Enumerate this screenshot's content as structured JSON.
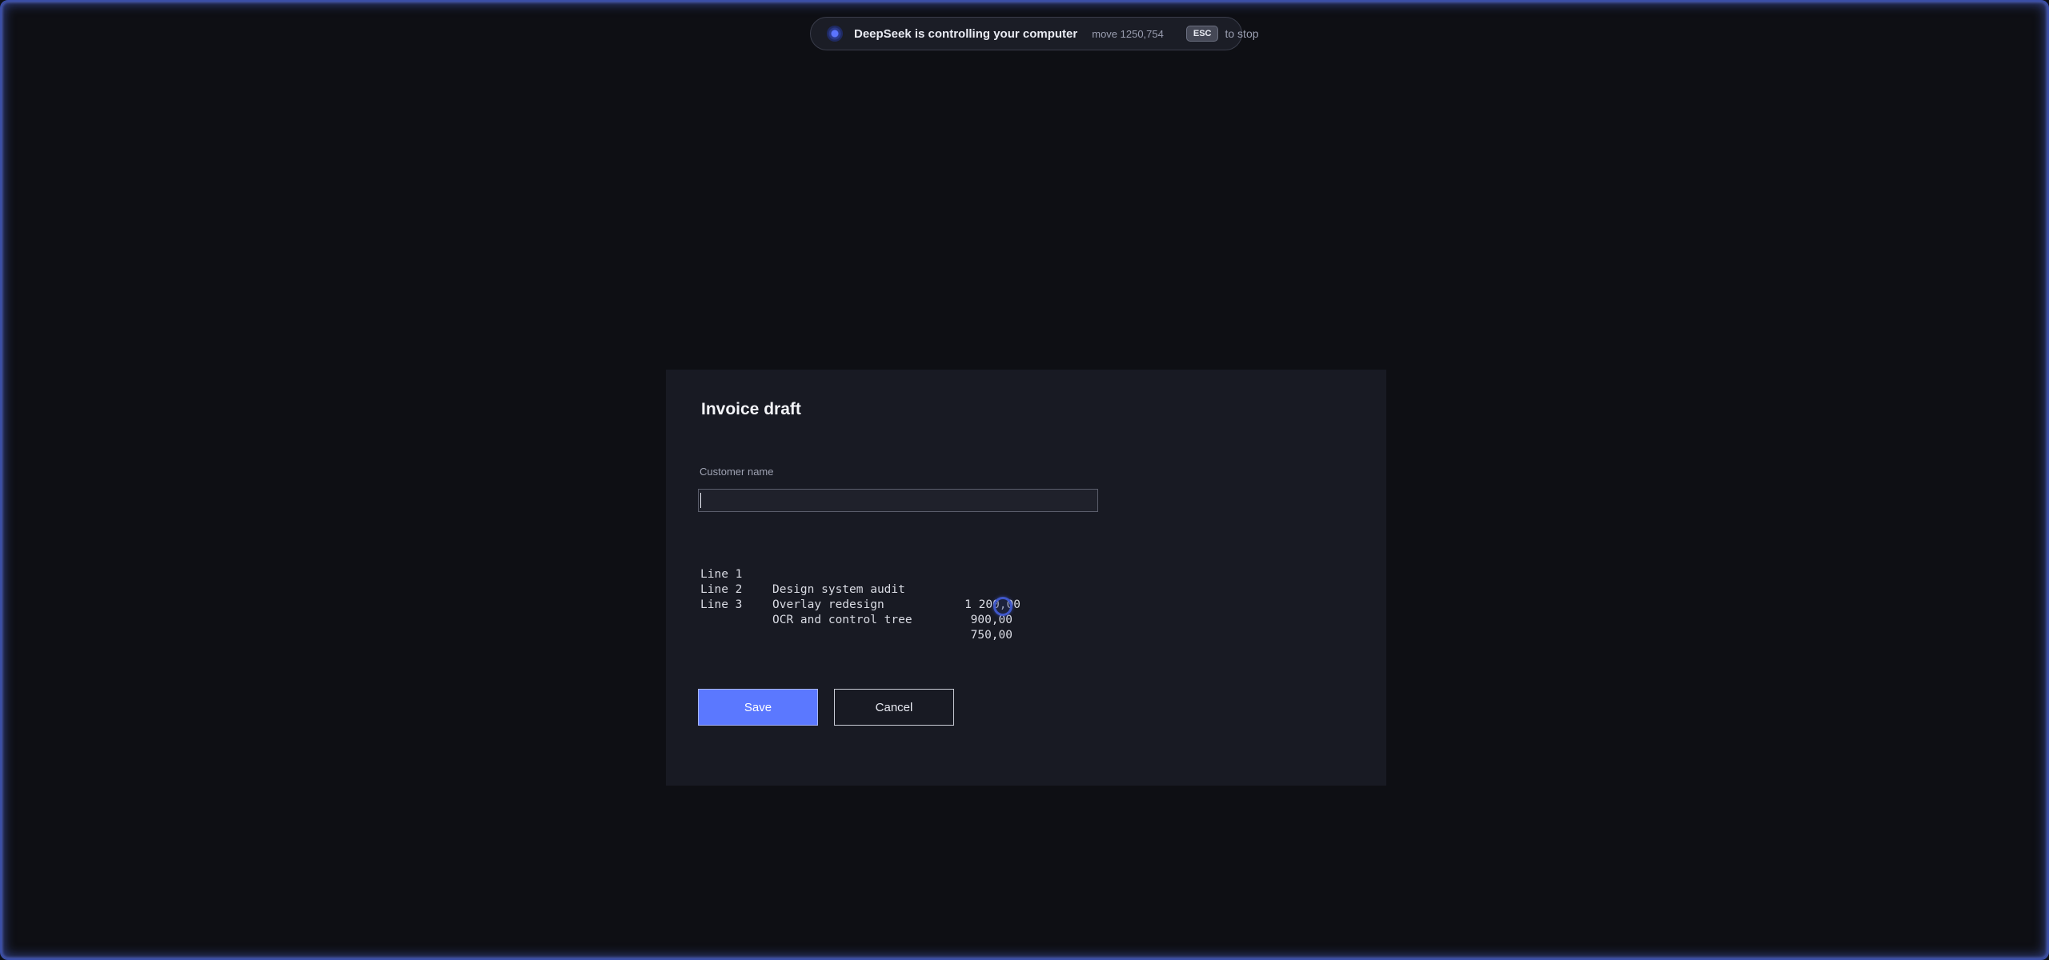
{
  "banner": {
    "title": "DeepSeek is controlling your computer",
    "action": "move 1250,754",
    "key": "ESC",
    "hint": "to stop"
  },
  "dialog": {
    "title": "Invoice draft",
    "customer": {
      "label": "Customer name",
      "value": "",
      "placeholder": ""
    },
    "lines": [
      {
        "num": "Line 1",
        "description": "Design system audit",
        "amount": "1 200,00"
      },
      {
        "num": "Line 2",
        "description": "Overlay redesign",
        "amount": "900,00"
      },
      {
        "num": "Line 3",
        "description": "OCR and control tree",
        "amount": "750,00"
      }
    ],
    "save_label": "Save",
    "cancel_label": "Cancel"
  },
  "colors": {
    "accent": "#5b78ff",
    "overlay_glow": "#3b4fa8",
    "background": "#0e0f14",
    "dialog": "#181a23"
  },
  "icons": {
    "status": "pulse-icon",
    "cursor": "agent-cursor-icon"
  }
}
